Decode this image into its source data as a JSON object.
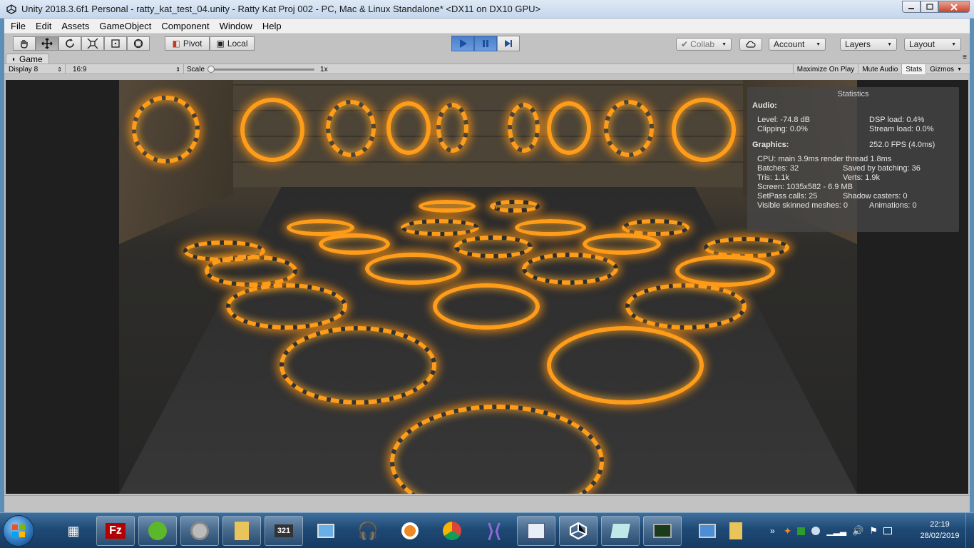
{
  "window": {
    "title": "Unity 2018.3.6f1 Personal - ratty_kat_test_04.unity - Ratty Kat Proj 002 - PC, Mac & Linux Standalone* <DX11 on DX10 GPU>"
  },
  "menu": [
    "File",
    "Edit",
    "Assets",
    "GameObject",
    "Component",
    "Window",
    "Help"
  ],
  "toolbar": {
    "pivot_label": "Pivot",
    "local_label": "Local",
    "collab_label": "Collab",
    "account_label": "Account",
    "layers_label": "Layers",
    "layout_label": "Layout"
  },
  "game_tab": {
    "title": "Game",
    "display": "Display 8",
    "aspect": "16:9",
    "scale_label": "Scale",
    "scale_value": "1x",
    "maximize_on_play": "Maximize On Play",
    "mute_audio": "Mute Audio",
    "stats": "Stats",
    "gizmos": "Gizmos"
  },
  "statistics": {
    "title": "Statistics",
    "audio_header": "Audio:",
    "level": "Level: -74.8 dB",
    "dsp_load": "DSP load: 0.4%",
    "clipping": "Clipping: 0.0%",
    "stream_load": "Stream load: 0.0%",
    "graphics_header": "Graphics:",
    "fps": "252.0 FPS (4.0ms)",
    "cpu": "CPU: main 3.9ms  render thread 1.8ms",
    "batches": "Batches: 32",
    "saved_by_batching": "Saved by batching: 36",
    "tris": "Tris: 1.1k",
    "verts": "Verts: 1.9k",
    "screen": "Screen: 1035x582 - 6.9 MB",
    "setpass": "SetPass calls: 25",
    "shadow_casters": "Shadow casters: 0",
    "skinned": "Visible skinned meshes: 0",
    "animations": "Animations: 0"
  },
  "taskbar": {
    "clock_time": "22:19",
    "clock_date": "28/02/2019",
    "icons": [
      "calculator-icon",
      "filezilla-icon",
      "green-app-icon",
      "speaker-icon",
      "folder-icon",
      "media-icon",
      "network-icon",
      "headphones-icon",
      "blender-icon",
      "chrome-icon",
      "visual-studio-icon",
      "paint-icon",
      "unity-icon",
      "notepad-icon",
      "terminal-icon",
      "computer-icon",
      "folder-icon"
    ]
  }
}
